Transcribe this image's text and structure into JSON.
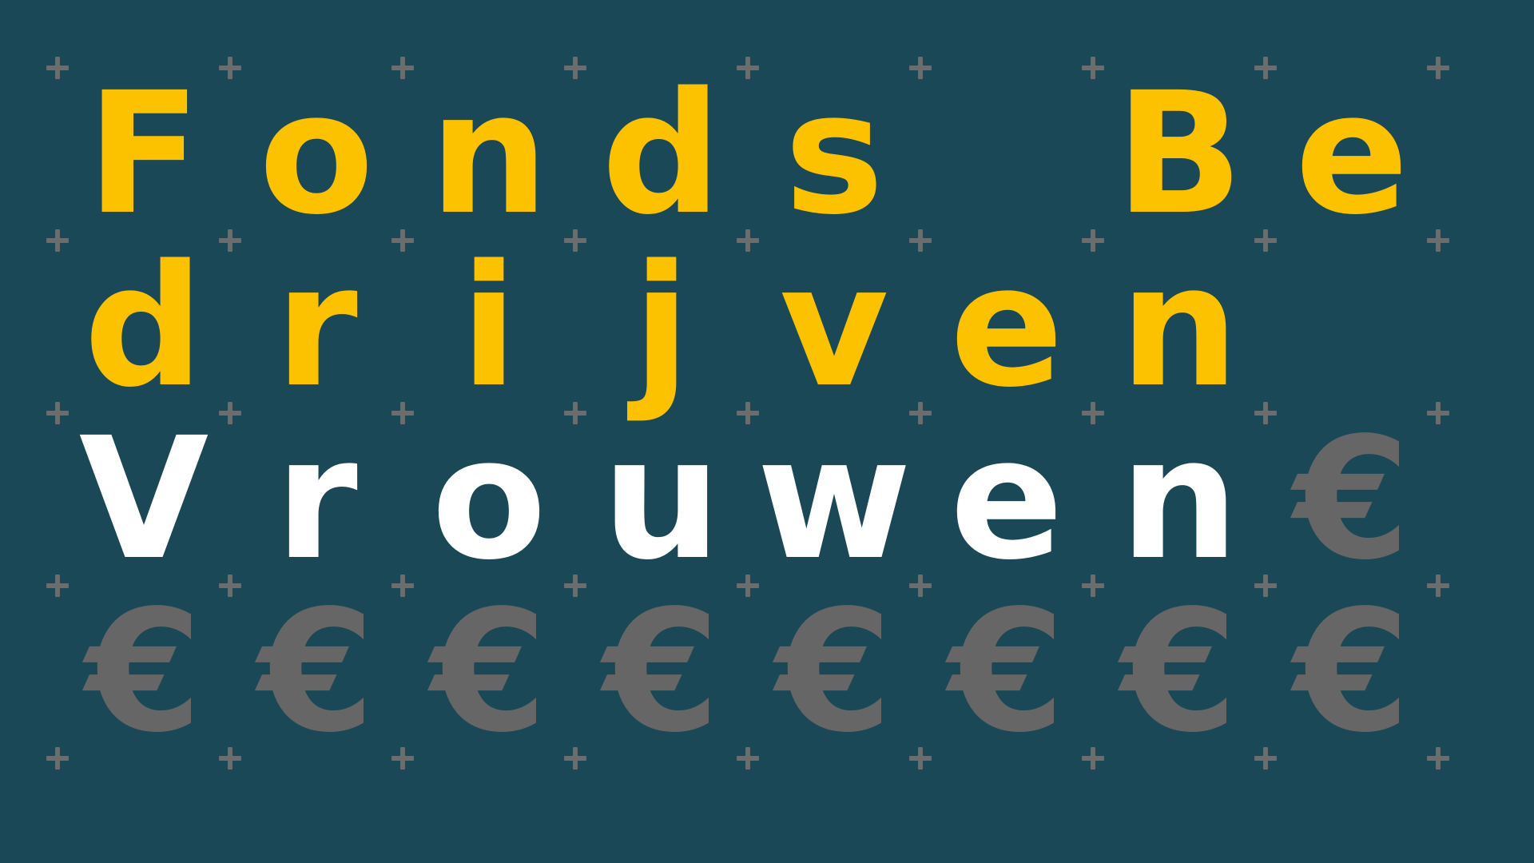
{
  "colors": {
    "background": "#1a4857",
    "title_yellow": "#fcc200",
    "title_white": "#ffffff",
    "euro_gray": "#666666",
    "plus_gray": "#6a6c6e"
  },
  "title": {
    "line1": [
      "F",
      "o",
      "n",
      "d",
      "s",
      "",
      "B",
      "e"
    ],
    "line2": [
      "d",
      "r",
      "i",
      "j",
      "v",
      "e",
      "n",
      ""
    ],
    "line3": [
      "V",
      "r",
      "o",
      "u",
      "w",
      "e",
      "n",
      "€"
    ],
    "line4": [
      "€",
      "€",
      "€",
      "€",
      "€",
      "€",
      "€",
      "€"
    ]
  },
  "decorations": {
    "plus_icon": "plus-icon",
    "euro_icon": "euro-icon"
  }
}
